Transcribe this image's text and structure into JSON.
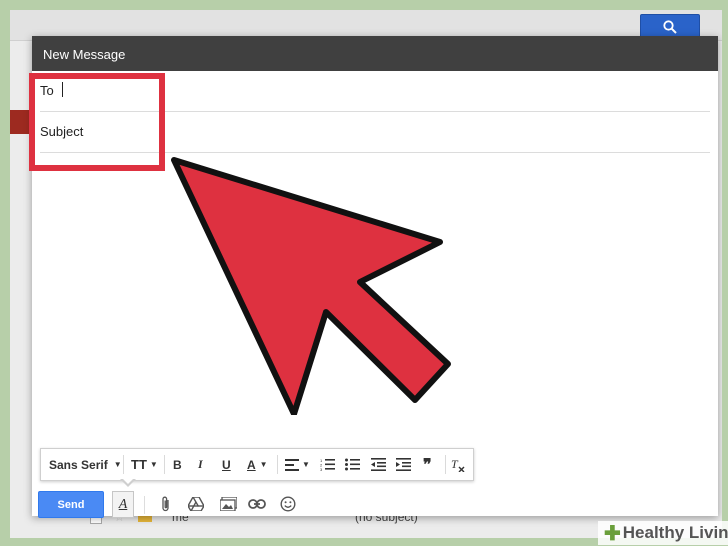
{
  "compose": {
    "title": "New Message",
    "to_label": "To",
    "subject_label": "Subject"
  },
  "format_bar": {
    "font": "Sans Serif",
    "icons": [
      "text-size-icon",
      "bold-icon",
      "italic-icon",
      "underline-icon",
      "text-color-icon",
      "align-icon",
      "numbered-list-icon",
      "bulleted-list-icon",
      "indent-less-icon",
      "indent-more-icon",
      "quote-icon",
      "remove-formatting-icon"
    ]
  },
  "toolbar": {
    "send_label": "Send",
    "icons": [
      "formatting-options-icon",
      "attach-icon",
      "drive-icon",
      "insert-photo-icon",
      "insert-link-icon",
      "emoji-icon"
    ]
  },
  "inbox": {
    "rows": [
      {
        "sender": "me",
        "subject": "(no subject)"
      }
    ]
  },
  "watermark": {
    "text": "Healthy Living"
  },
  "colors": {
    "highlight": "#de3140",
    "arrow": "#de3140",
    "send": "#4a8af4",
    "header": "#404040"
  }
}
